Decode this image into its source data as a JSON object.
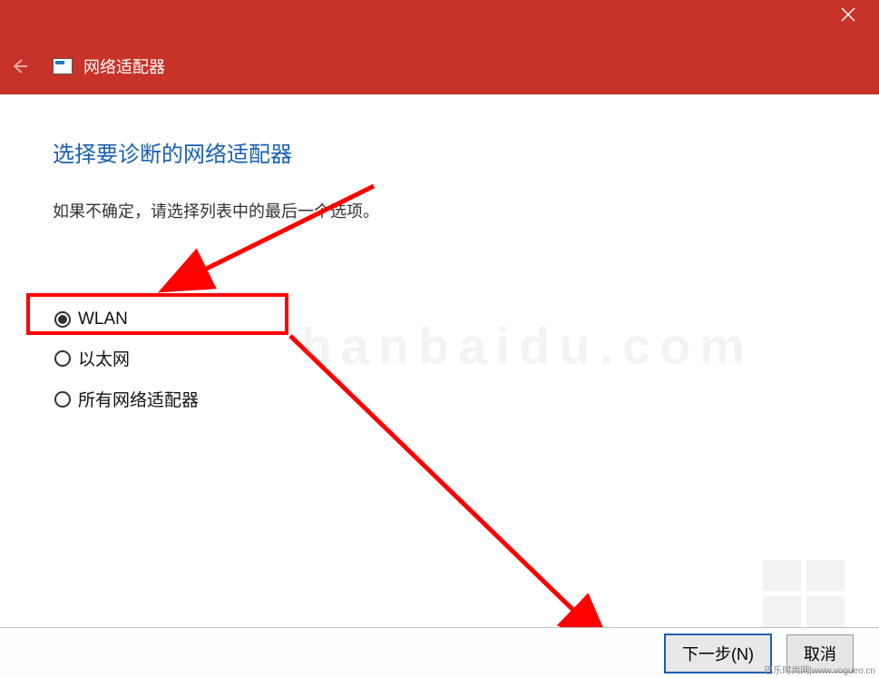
{
  "header": {
    "title": "网络适配器"
  },
  "main": {
    "heading": "选择要诊断的网络适配器",
    "instruction": "如果不确定，请选择列表中的最后一个选项。",
    "options": [
      {
        "label": "WLAN",
        "checked": true
      },
      {
        "label": "以太网",
        "checked": false
      },
      {
        "label": "所有网络适配器",
        "checked": false
      }
    ]
  },
  "footer": {
    "next_label": "下一步(N)",
    "cancel_label": "取消"
  },
  "watermark": {
    "site_text": "巴乐时尚网|www.vogueo.cn",
    "bg_text": "hanbaidu.com"
  }
}
